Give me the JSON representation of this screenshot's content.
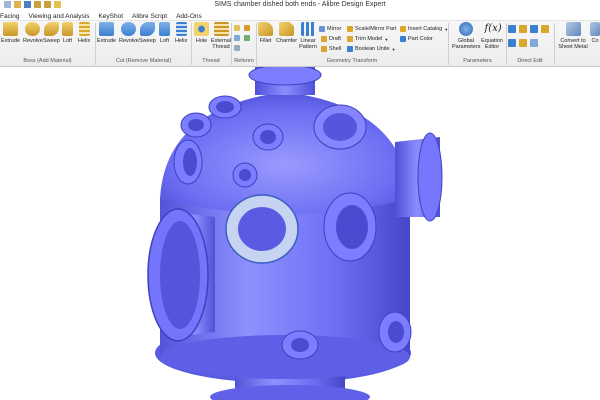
{
  "window": {
    "title": "SIMS chamber dished both ends - Alibre Design Expert"
  },
  "menu": [
    "Facing",
    "Viewing and Analysis",
    "KeyShot",
    "Alibre Script",
    "Add-Ons"
  ],
  "ribbon": {
    "boss": {
      "group_label": "Boss (Add Material)",
      "tools": [
        "Extrude",
        "Revolve",
        "Sweep",
        "Loft",
        "Helix"
      ]
    },
    "cut": {
      "group_label": "Cut (Remove Material)",
      "tools": [
        "Extrude",
        "Revolve",
        "Sweep",
        "Loft",
        "Helix"
      ]
    },
    "thread": {
      "group_label": "Thread",
      "tools": [
        "Hole",
        "External Thread"
      ]
    },
    "reference": {
      "group_label": "Referen"
    },
    "geometry": {
      "group_label": "Geometry Transform",
      "tools": [
        "Fillet",
        "Chamfer",
        "Linear Pattern"
      ],
      "small_items": [
        "Mirror",
        "Draft",
        "Shell",
        "Scale/Mirror Part",
        "Trim Model",
        "Boolean Unite",
        "Insert Catalog",
        "Part Color"
      ]
    },
    "parameters": {
      "group_label": "Parameters",
      "tools": [
        "Global Parameters",
        "Equation Editor"
      ],
      "fx_glyph": "f(x)"
    },
    "direct_edit": {
      "group_label": "Direct Edit"
    },
    "sheet_metal": {
      "tools": [
        "Convert to Sheet Metal",
        "Co"
      ]
    }
  },
  "colors": {
    "model_body": "#6b6cf2",
    "model_dark": "#4f50d8",
    "ribbon_bg": "#f2f2f2",
    "icon_gold": "#d9a72b",
    "icon_blue": "#3b7fd1"
  }
}
